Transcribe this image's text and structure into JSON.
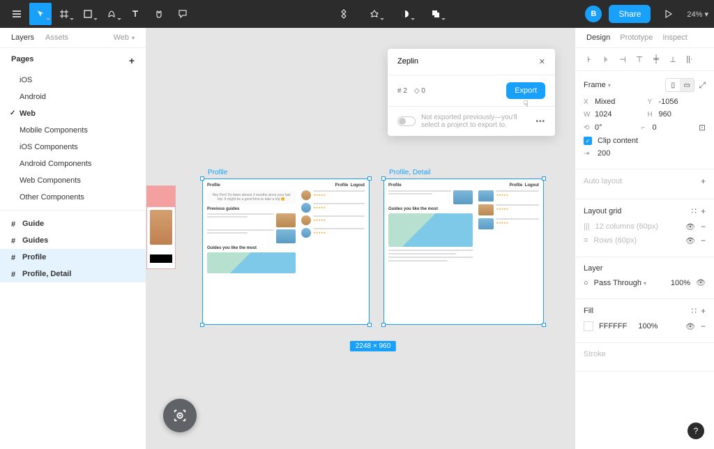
{
  "toolbar": {
    "avatar_initial": "B",
    "share_label": "Share",
    "zoom": "24%"
  },
  "left_panel": {
    "tabs": {
      "layers": "Layers",
      "assets": "Assets",
      "right": "Web"
    },
    "pages_header": "Pages",
    "pages": [
      {
        "label": "iOS"
      },
      {
        "label": "Android"
      },
      {
        "label": "Web",
        "selected": true
      },
      {
        "label": "Mobile Components"
      },
      {
        "label": "iOS Components"
      },
      {
        "label": "Android Components"
      },
      {
        "label": "Web Components"
      },
      {
        "label": "Other Components"
      }
    ],
    "layers": [
      {
        "label": "Guide"
      },
      {
        "label": "Guides"
      },
      {
        "label": "Profile",
        "selected": true
      },
      {
        "label": "Profile, Detail",
        "selected": true
      }
    ]
  },
  "canvas": {
    "frame1_label": "Profile",
    "frame2_label": "Profile, Detail",
    "dimensions": "2248 × 960",
    "mockup": {
      "title": "Profile",
      "nav1": "Profile",
      "nav2": "Logout",
      "hero": "Hey Peri! It's been almost 3 months since your last trip. It might be a good time to take a trip 😊",
      "section1": "Previous guides",
      "section2": "Guides you like the most"
    }
  },
  "zeplin": {
    "title": "Zeplin",
    "frame_count": "2",
    "component_count": "0",
    "export_label": "Export",
    "footer_text": "Not exported previously—you'll select a project to export to."
  },
  "right_panel": {
    "tabs": {
      "design": "Design",
      "prototype": "Prototype",
      "inspect": "Inspect"
    },
    "frame": {
      "header": "Frame",
      "x_label": "X",
      "x_val": "Mixed",
      "y_label": "Y",
      "y_val": "-1056",
      "w_label": "W",
      "w_val": "1024",
      "h_label": "H",
      "h_val": "960",
      "rotation": "0°",
      "radius": "0",
      "clip_label": "Clip content",
      "constraint_val": "200"
    },
    "auto_layout": {
      "header": "Auto layout"
    },
    "layout_grid": {
      "header": "Layout grid",
      "row1": "12 columns (60px)",
      "row2": "Rows (60px)"
    },
    "layer": {
      "header": "Layer",
      "blend": "Pass Through",
      "opacity": "100%"
    },
    "fill": {
      "header": "Fill",
      "hex": "FFFFFF",
      "opacity": "100%"
    },
    "stroke": {
      "header": "Stroke"
    }
  }
}
